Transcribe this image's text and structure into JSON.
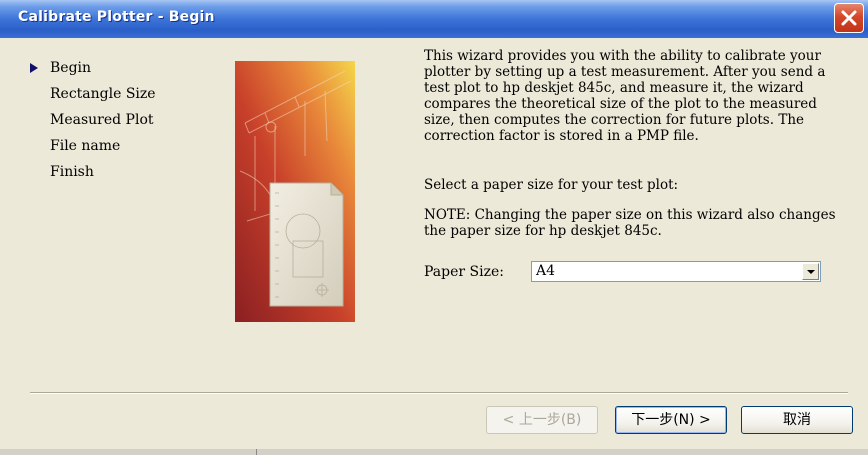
{
  "window": {
    "title": "Calibrate Plotter - Begin"
  },
  "nav": {
    "items": [
      "Begin",
      "Rectangle Size",
      "Measured Plot",
      "File name",
      "Finish"
    ],
    "current": "Begin"
  },
  "content": {
    "description": "This wizard provides you with the ability to calibrate your plotter by setting up a test measurement. After you send a test plot to hp deskjet 845c, and measure it, the wizard compares the theoretical size of the plot to the measured size, then computes the correction for future plots. The correction factor is stored in a PMP file.",
    "prompt": "Select a paper size for your test plot:",
    "note": "NOTE: Changing the paper size on this wizard also changes the paper size for hp deskjet 845c.",
    "paper_size_label": "Paper Size:",
    "paper_size_value": "A4"
  },
  "buttons": {
    "back": "< 上一步(B)",
    "next": "下一步(N) >",
    "cancel": "取消"
  },
  "icons": {
    "close": "close-icon",
    "current_step": "arrow-right-icon",
    "dropdown": "chevron-down-icon",
    "illustration": "plotter-illustration"
  },
  "colors": {
    "titlebar": "#2a5fc8",
    "close": "#d4482a",
    "window_bg": "#ece9d8",
    "nav_arrow": "#10106a"
  }
}
